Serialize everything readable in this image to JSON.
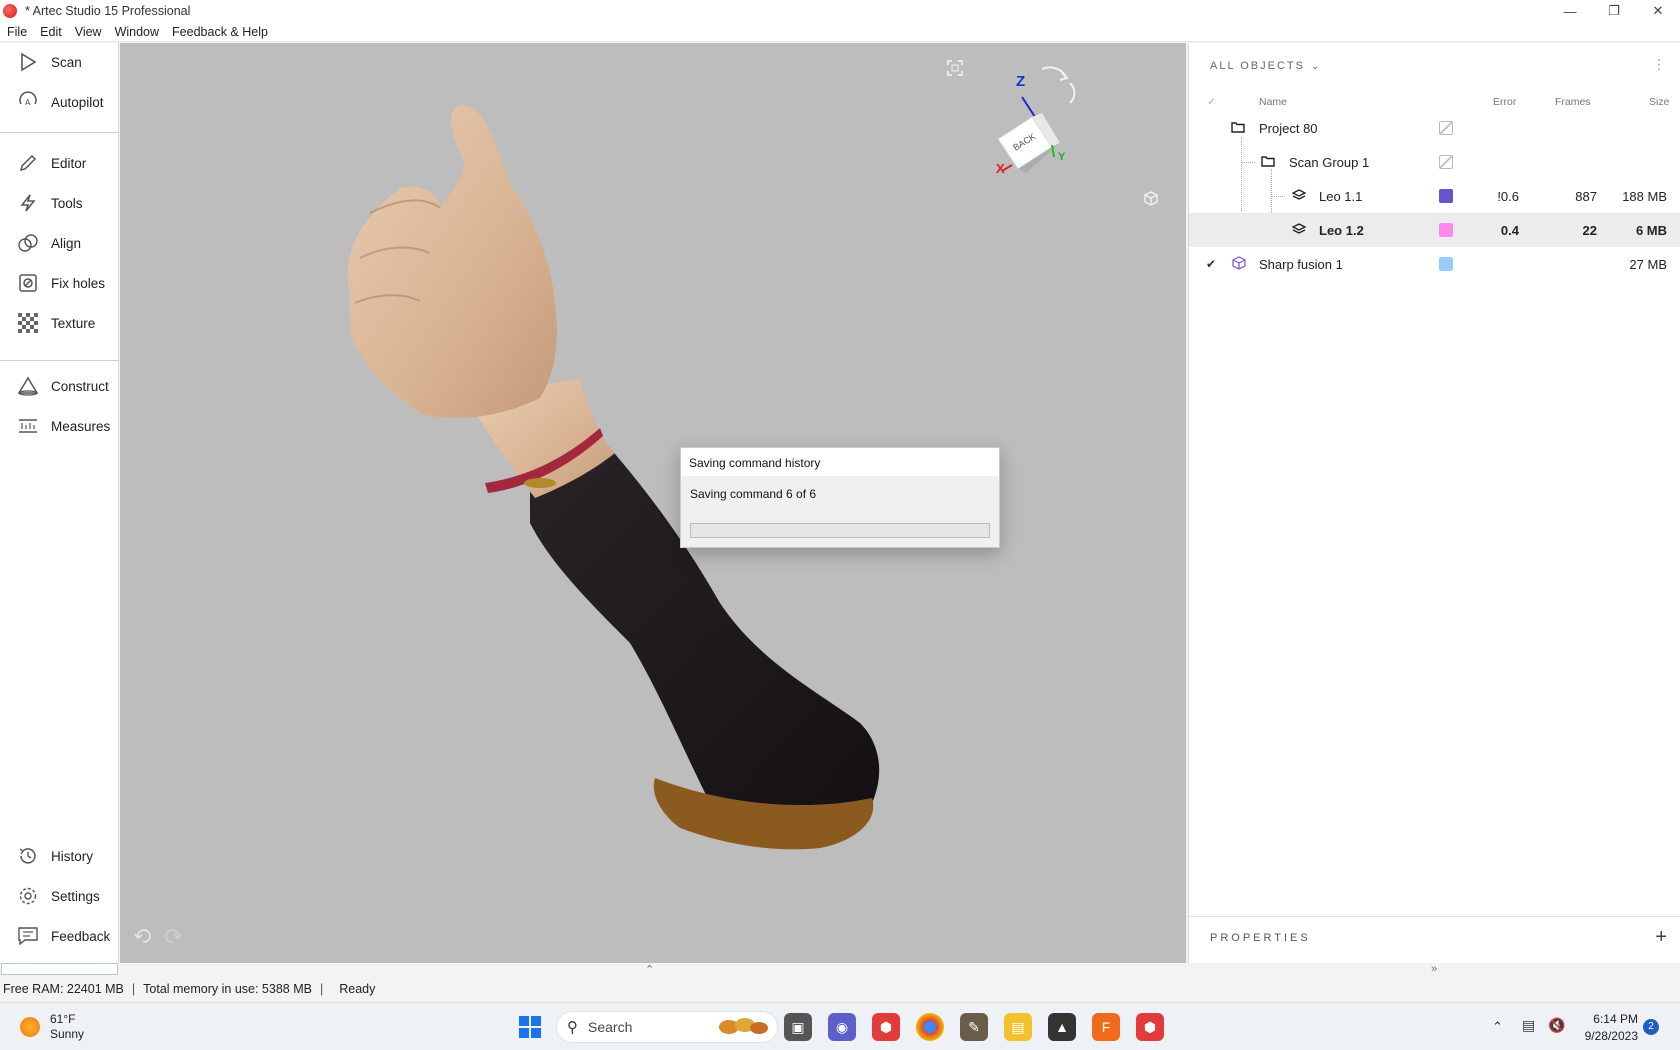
{
  "window": {
    "title": "* Artec Studio 15 Professional",
    "controls": [
      "—",
      "❐",
      "✕"
    ]
  },
  "menu": [
    "File",
    "Edit",
    "View",
    "Window",
    "Feedback & Help"
  ],
  "sidebar": {
    "items": [
      {
        "label": "Scan",
        "icon": "play-icon"
      },
      {
        "label": "Autopilot",
        "icon": "autopilot-icon"
      },
      {
        "label": "Editor",
        "icon": "pencil-icon"
      },
      {
        "label": "Tools",
        "icon": "lightning-icon"
      },
      {
        "label": "Align",
        "icon": "align-icon"
      },
      {
        "label": "Fix holes",
        "icon": "fix-holes-icon"
      },
      {
        "label": "Texture",
        "icon": "checker-icon"
      },
      {
        "label": "Construct",
        "icon": "cone-icon"
      },
      {
        "label": "Measures",
        "icon": "ruler-icon"
      }
    ],
    "bottom_items": [
      {
        "label": "History",
        "icon": "history-icon"
      },
      {
        "label": "Settings",
        "icon": "gear-icon"
      },
      {
        "label": "Feedback",
        "icon": "chat-icon"
      }
    ]
  },
  "viewport": {
    "nav_cube": {
      "face": "BACK",
      "axes": {
        "z": "Z",
        "x": "X",
        "y": "Y"
      }
    }
  },
  "dialog": {
    "title": "Saving command history",
    "message": "Saving command 6 of 6",
    "progress": 0
  },
  "objects_panel": {
    "header": "ALL OBJECTS",
    "columns": {
      "name": "Name",
      "error": "Error",
      "frames": "Frames",
      "size": "Size"
    },
    "rows": [
      {
        "name": "Project 80",
        "error": "",
        "frames": "",
        "size": "",
        "color": "none",
        "checked": false,
        "icon": "folder-icon",
        "selected": false,
        "bold": false
      },
      {
        "name": "Scan Group 1",
        "error": "",
        "frames": "",
        "size": "",
        "color": "none",
        "checked": false,
        "icon": "folder-icon",
        "selected": false,
        "bold": false
      },
      {
        "name": "Leo 1.1",
        "error": "!0.6",
        "frames": "887",
        "size": "188 MB",
        "color": "#6655cc",
        "checked": false,
        "icon": "layers-icon",
        "selected": false,
        "bold": false
      },
      {
        "name": "Leo 1.2",
        "error": "0.4",
        "frames": "22",
        "size": "6 MB",
        "color": "#ff88ee",
        "checked": false,
        "icon": "layers-icon",
        "selected": true,
        "bold": true
      },
      {
        "name": "Sharp fusion 1",
        "error": "",
        "frames": "",
        "size": "27 MB",
        "color": "#99ccff",
        "checked": true,
        "icon": "cube-icon",
        "selected": false,
        "bold": false
      }
    ],
    "properties_label": "PROPERTIES"
  },
  "statusbar": {
    "free_ram": "Free RAM: 22401 MB",
    "total_memory": "Total memory in use: 5388 MB",
    "state": "Ready"
  },
  "taskbar": {
    "weather_temp": "61°F",
    "weather_desc": "Sunny",
    "search_placeholder": "Search",
    "time": "6:14 PM",
    "date": "9/28/2023",
    "notifications": "2"
  }
}
